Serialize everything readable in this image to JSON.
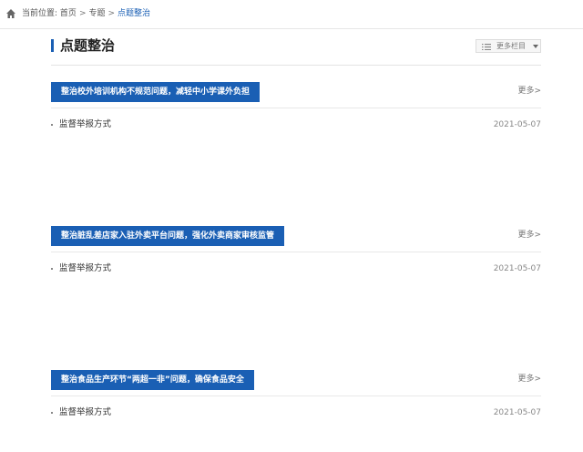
{
  "breadcrumb": {
    "home_icon": "home-icon",
    "prefix": "当前位置:",
    "items": [
      "首页",
      "专题",
      "点题整治"
    ],
    "separator": ">"
  },
  "header": {
    "title": "点题整治",
    "more_columns_label": "更多栏目",
    "accent_color": "#1a5fb4"
  },
  "sections": [
    {
      "title": "整治校外培训机构不规范问题，减轻中小学课外负担",
      "more": "更多>",
      "items": [
        {
          "name": "监督举报方式",
          "date": "2021-05-07"
        }
      ]
    },
    {
      "title": "整治脏乱差店家入驻外卖平台问题，强化外卖商家审核监管",
      "more": "更多>",
      "items": [
        {
          "name": "监督举报方式",
          "date": "2021-05-07"
        }
      ]
    },
    {
      "title": "整治食品生产环节“两超一非”问题，确保食品安全",
      "more": "更多>",
      "items": [
        {
          "name": "监督举报方式",
          "date": "2021-05-07"
        }
      ]
    }
  ]
}
